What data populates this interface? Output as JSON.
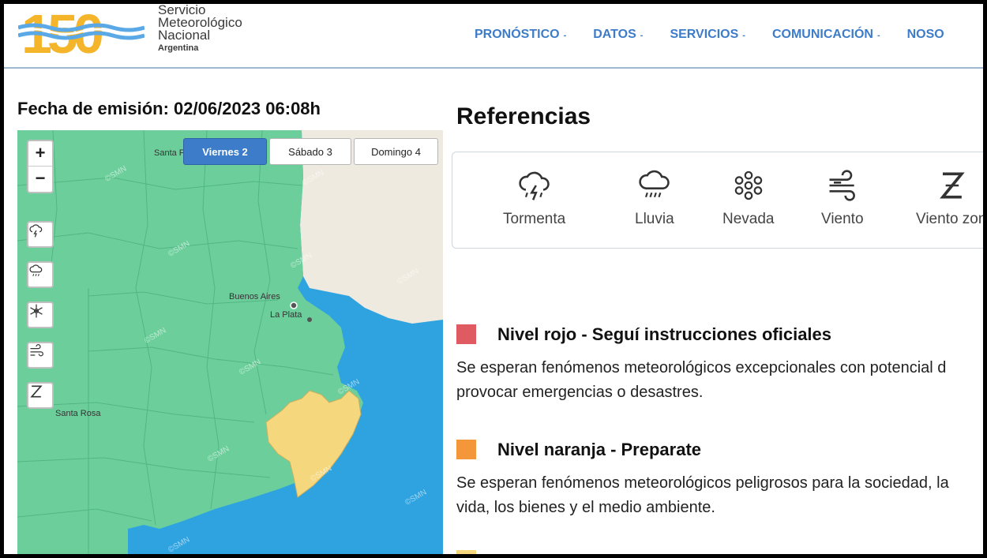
{
  "header": {
    "logo_number": "150",
    "org_line1": "Servicio",
    "org_line2": "Meteorológico",
    "org_line3": "Nacional",
    "org_country": "Argentina",
    "nav": [
      {
        "label": "PRONÓSTICO",
        "has_caret": true
      },
      {
        "label": "DATOS",
        "has_caret": true
      },
      {
        "label": "SERVICIOS",
        "has_caret": true
      },
      {
        "label": "COMUNICACIÓN",
        "has_caret": true
      },
      {
        "label": "NOSO",
        "has_caret": false
      }
    ],
    "caret": "-"
  },
  "fecha": {
    "label": "Fecha de emisión: 02/06/2023 06:08h"
  },
  "map": {
    "zoom_in": "+",
    "zoom_out": "−",
    "day_tabs": [
      {
        "label": "Viernes 2",
        "active": true
      },
      {
        "label": "Sábado 3",
        "active": false
      },
      {
        "label": "Domingo 4",
        "active": false
      }
    ],
    "layer_buttons": [
      "storm-icon",
      "rain-icon",
      "snow-icon",
      "wind-icon",
      "zonda-icon"
    ],
    "places": [
      "Santa Fe",
      "Buenos Aires",
      "La Plata",
      "Santa Rosa"
    ],
    "watermark": "©SMN",
    "colors": {
      "green": "#6ccf9b",
      "yellow": "#f5d77e",
      "sea": "#2ea3e0",
      "land": "#efeae0"
    }
  },
  "references": {
    "title": "Referencias",
    "items": [
      {
        "label": "Tormenta",
        "icon": "storm-icon"
      },
      {
        "label": "Lluvia",
        "icon": "rain-icon"
      },
      {
        "label": "Nevada",
        "icon": "snow-icon"
      },
      {
        "label": "Viento",
        "icon": "wind-icon"
      },
      {
        "label": "Viento zon",
        "icon": "zonda-icon"
      }
    ]
  },
  "levels": [
    {
      "color": "#e05a61",
      "title": "Nivel rojo - Seguí instrucciones oficiales",
      "desc_line1": "Se esperan fenómenos meteorológicos excepcionales con potencial d",
      "desc_line2": "provocar emergencias o desastres."
    },
    {
      "color": "#f4973b",
      "title": "Nivel naranja - Preparate",
      "desc_line1": "Se esperan fenómenos meteorológicos peligrosos para la sociedad, la",
      "desc_line2": "vida, los bienes y el medio ambiente."
    }
  ]
}
